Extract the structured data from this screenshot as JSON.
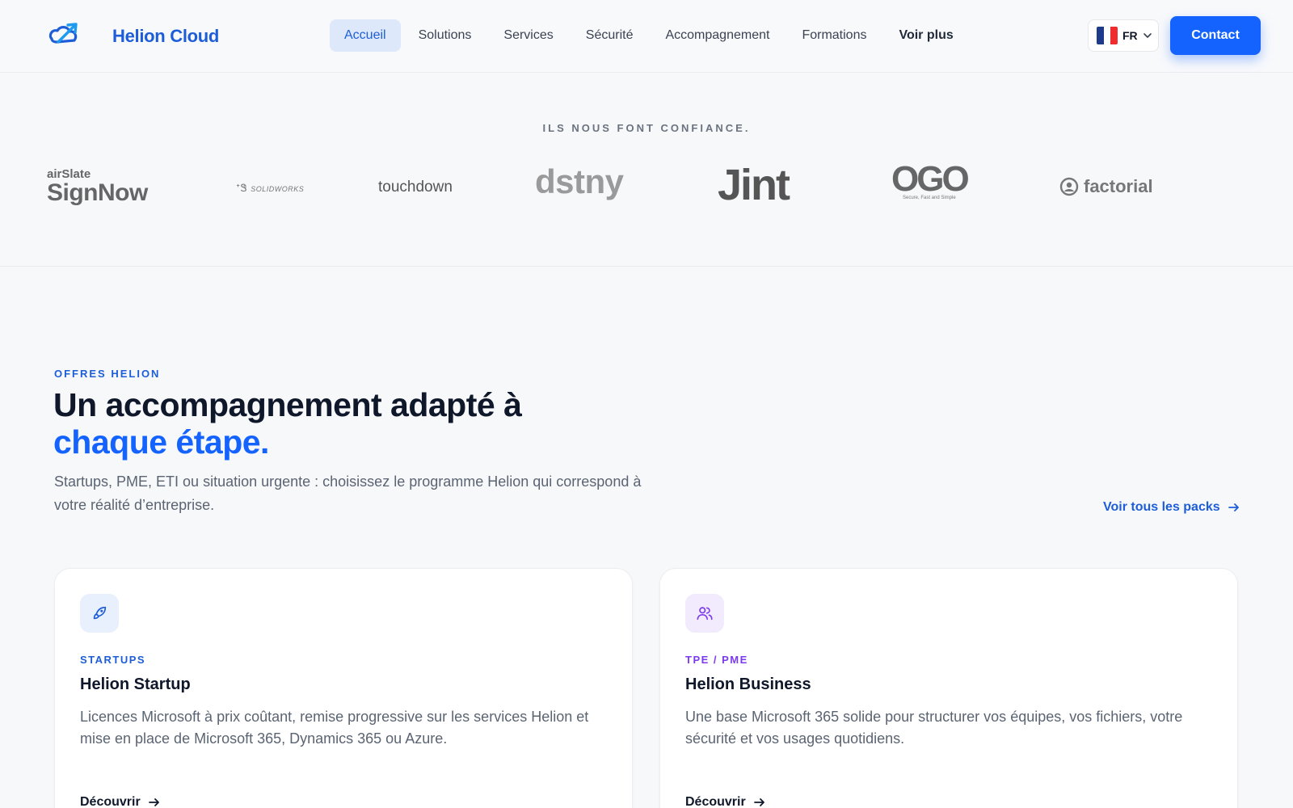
{
  "header": {
    "brand": "Helion Cloud",
    "nav": [
      {
        "label": "Accueil",
        "active": true
      },
      {
        "label": "Solutions"
      },
      {
        "label": "Services"
      },
      {
        "label": "Sécurité"
      },
      {
        "label": "Accompagnement"
      },
      {
        "label": "Formations"
      },
      {
        "label": "Voir plus"
      }
    ],
    "language": "FR",
    "contact_label": "Contact"
  },
  "trust": {
    "title": "ILS NOUS FONT CONFIANCE.",
    "logos": {
      "signnow_top": "airSlate",
      "signnow_main": "SignNow",
      "solidworks": "SOLIDWORKS",
      "touchdown": "touchdown",
      "dstny": "dstny",
      "jint": "Jint",
      "ogo_main": "OGO",
      "ogo_tagline": "Secure, Fast and Simple",
      "factorial": "factorial"
    }
  },
  "offers": {
    "eyebrow": "OFFRES HELION",
    "headline_line1": "Un accompagnement adapté à",
    "headline_line2": "chaque étape.",
    "intro": "Startups, PME, ETI ou situation urgente : choisissez le programme Helion qui correspond à votre réalité d’entreprise.",
    "see_all": "Voir tous les packs",
    "cards": [
      {
        "tag": "STARTUPS",
        "title": "Helion Startup",
        "description": "Licences Microsoft à prix coûtant, remise progressive sur les services Helion et mise en place de Microsoft 365, Dynamics 365 ou Azure.",
        "link": "Découvrir",
        "icon": "rocket-icon"
      },
      {
        "tag": "TPE / PME",
        "title": "Helion Business",
        "description": "Une base Microsoft 365 solide pour structurer vos équipes, vos fichiers, votre sécurité et vos usages quotidiens.",
        "link": "Découvrir",
        "icon": "users-icon"
      }
    ]
  },
  "colors": {
    "brand_blue": "#1463ff",
    "accent_purple": "#7c3aed",
    "flag_blue": "#1e3a8a",
    "flag_red": "#ef2b2d"
  }
}
